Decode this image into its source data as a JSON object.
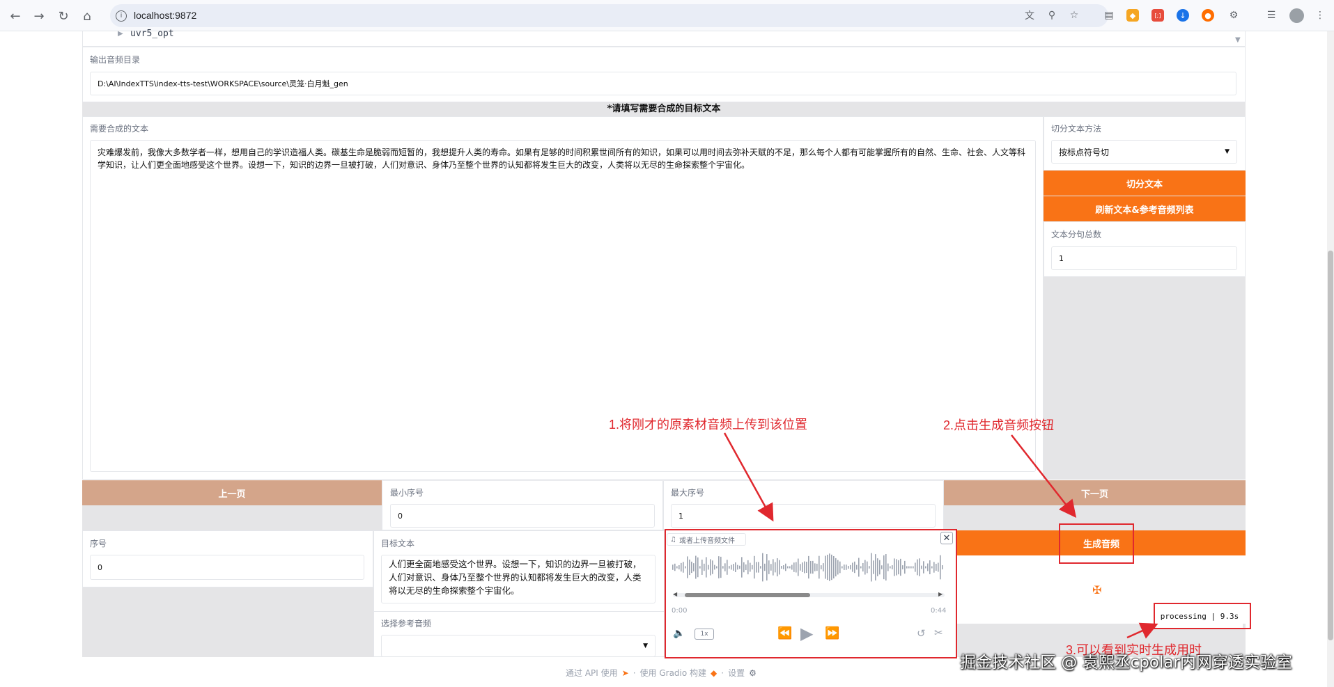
{
  "browser": {
    "url": "localhost:9872",
    "extension_labels": [
      "[;]"
    ]
  },
  "top": {
    "folder_label": "uvr5_opt",
    "output_dir_label": "输出音频目录",
    "output_dir_value": "D:\\AI\\IndexTTS\\index-tts-test\\WORKSPACE\\source\\灵笼·白月魁_gen"
  },
  "section_header": "*请填写需要合成的目标文本",
  "text_input": {
    "label": "需要合成的文本",
    "value": "灾难爆发前，我像大多数学者一样，想用自己的学识造福人类。碳基生命是脆弱而短暂的，我想提升人类的寿命。如果有足够的时间积累世间所有的知识，如果可以用时间去弥补天赋的不足，那么每个人都有可能掌握所有的自然、生命、社会、人文等科学知识，让人们更全面地感受这个世界。设想一下，知识的边界一旦被打破，人们对意识、身体乃至整个世界的认知都将发生巨大的改变，人类将以无尽的生命探索整个宇宙化。"
  },
  "split": {
    "method_label": "切分文本方法",
    "method_value": "按标点符号切",
    "split_button": "切分文本",
    "refresh_button": "刷新文本&参考音频列表",
    "count_label": "文本分句总数",
    "count_value": "1"
  },
  "pager": {
    "prev_button": "上一页",
    "next_button": "下一页",
    "min_label": "最小序号",
    "min_value": "0",
    "max_label": "最大序号",
    "max_value": "1"
  },
  "row": {
    "index_label": "序号",
    "index_value": "0",
    "target_label": "目标文本",
    "target_value": "个人都有可能掌握所有的自然、生命、社会、人文等科学知识，让人们更全面地感受这个世界。设想一下，知识的边界一旦被打破，人们对意识、身体乃至整个世界的认知都将发生巨大的改变，人类将以无尽的生命探索整个宇宙化。",
    "ref_audio_label": "选择参考音频"
  },
  "audio": {
    "tab_label": "或者上传音频文件",
    "time_start": "0:00",
    "time_end": "0:44",
    "speed": "1x"
  },
  "generate": {
    "button": "生成音频",
    "processing": "processing | 9.3s"
  },
  "annotations": {
    "a1": "1.将刚才的原素材音频上传到该位置",
    "a2": "2.点击生成音频按钮",
    "a3": "3.可以看到实时生成用时"
  },
  "footer": {
    "api": "通过 API 使用",
    "gradio": "使用 Gradio 构建",
    "settings": "设置",
    "sep": "·"
  },
  "watermark": "掘金技术社区 @ 袁熙丞cpolar内网穿透实验室",
  "colors": {
    "accent": "#f97316",
    "secondary": "#d4a58a",
    "annotation": "#e0282e"
  }
}
